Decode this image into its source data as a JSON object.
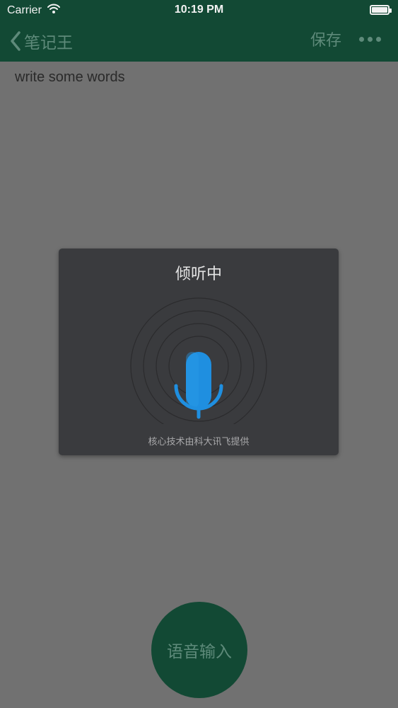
{
  "status_bar": {
    "carrier": "Carrier",
    "time": "10:19 PM"
  },
  "nav": {
    "back_label": "笔记王",
    "save_label": "保存"
  },
  "editor": {
    "content": "write some words"
  },
  "voice_dialog": {
    "title": "倾听中",
    "footer": "核心技术由科大讯飞提供"
  },
  "voice_input_button": {
    "label": "语音输入"
  },
  "colors": {
    "nav_bg": "#124934",
    "overlay_bg": "#717171",
    "dialog_bg": "#3a3b3e",
    "mic_blue": "#1f8fe0"
  },
  "icons": [
    "wifi-icon",
    "battery-icon",
    "back-chevron-icon",
    "more-icon",
    "microphone-icon",
    "sound-wave-icon"
  ]
}
